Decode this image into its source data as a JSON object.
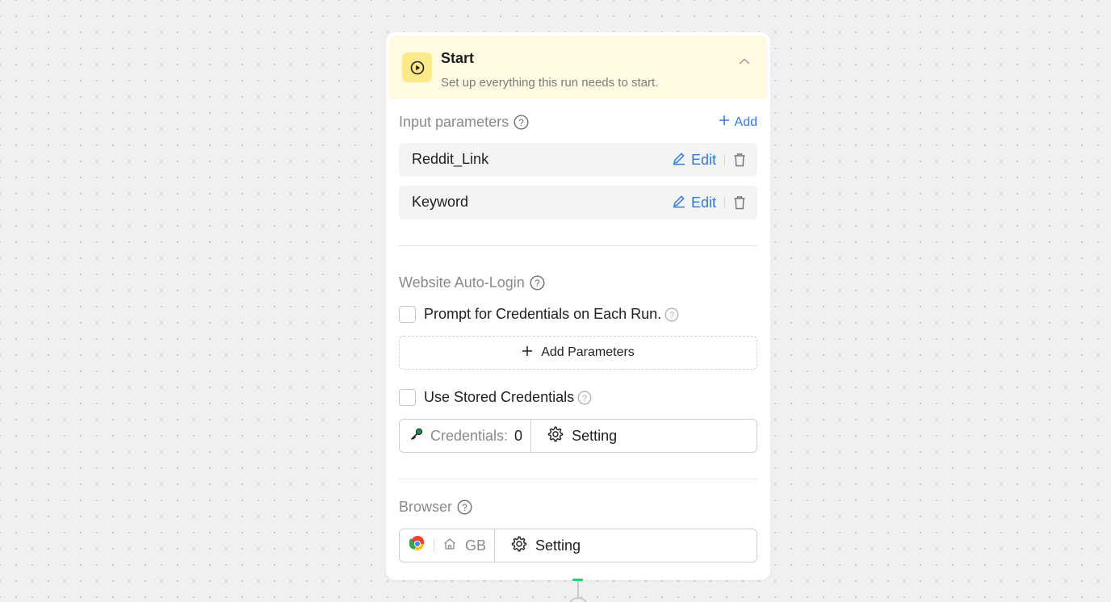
{
  "header": {
    "title": "Start",
    "subtitle": "Set up everything this run needs to start."
  },
  "input_parameters": {
    "label": "Input parameters",
    "add_label": "Add",
    "items": [
      {
        "name": "Reddit_Link",
        "edit_label": "Edit"
      },
      {
        "name": "Keyword",
        "edit_label": "Edit"
      }
    ]
  },
  "auto_login": {
    "label": "Website Auto-Login",
    "prompt_label": "Prompt for Credentials on Each Run.",
    "prompt_checked": false,
    "add_parameters_label": "Add Parameters",
    "stored_label": "Use Stored Credentials",
    "stored_checked": false,
    "credentials_label": "Credentials:",
    "credentials_count": "0",
    "setting_label": "Setting"
  },
  "browser": {
    "label": "Browser",
    "region": "GB",
    "setting_label": "Setting"
  },
  "colors": {
    "accent": "#2f7ae5",
    "header_bg": "#fffbe3",
    "start_icon_bg": "#fce98a",
    "connector_cap": "#2ecc71"
  },
  "icons": {
    "start": "play-circle-icon",
    "collapse": "chevron-up-icon",
    "help": "question-circle-icon",
    "add": "plus-icon",
    "edit": "pencil-icon",
    "delete": "trash-icon",
    "credential": "key-icon",
    "setting": "gear-icon",
    "browser": "chrome-icon",
    "home": "home-icon"
  }
}
